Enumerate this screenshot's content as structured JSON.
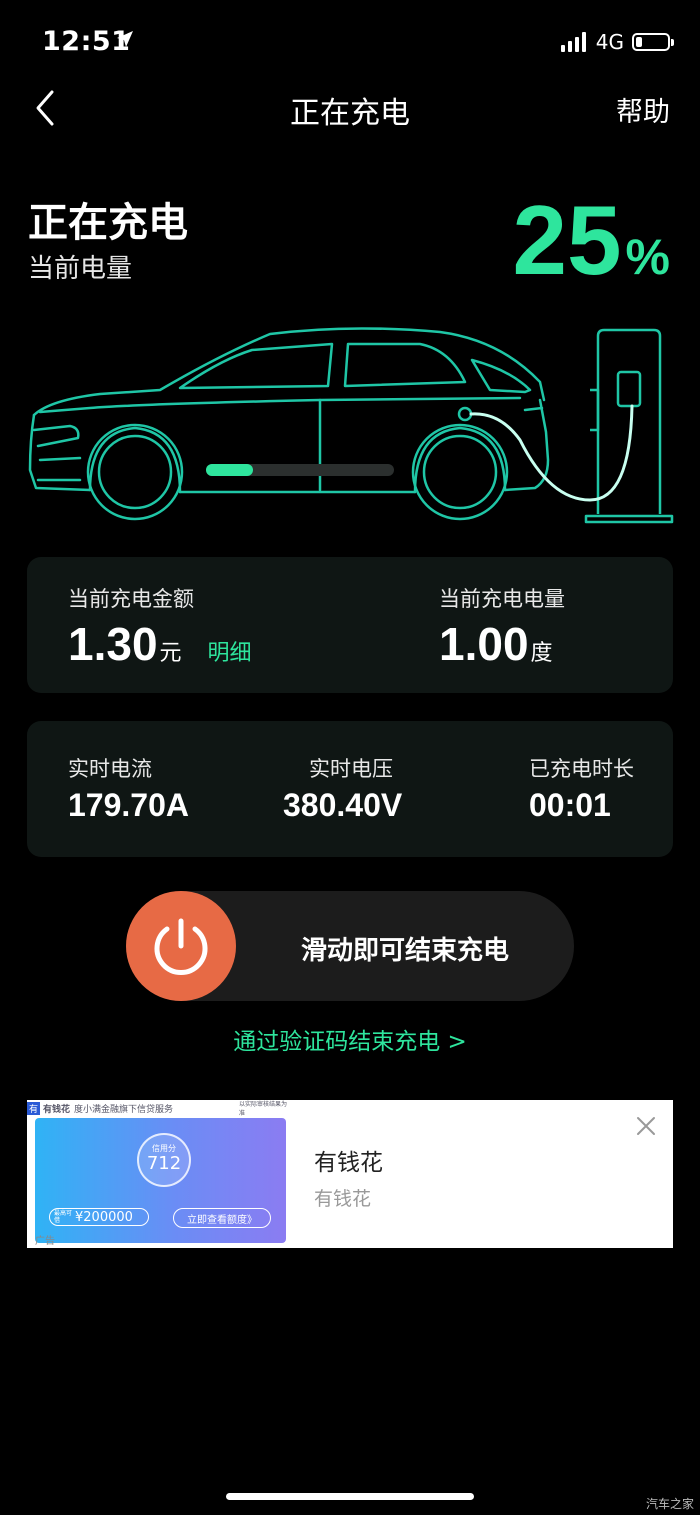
{
  "status_bar": {
    "time": "12:51",
    "network": "4G",
    "battery_level": 0.2
  },
  "nav": {
    "title": "正在充电",
    "help": "帮助"
  },
  "header": {
    "status": "正在充电",
    "label": "当前电量",
    "percent": "25",
    "percent_unit": "%"
  },
  "charge_progress": 0.25,
  "summary": {
    "amount_label": "当前充电金额",
    "amount_value": "1.30",
    "amount_unit": "元",
    "detail_link": "明细",
    "energy_label": "当前充电电量",
    "energy_value": "1.00",
    "energy_unit": "度"
  },
  "metrics": [
    {
      "label": "实时电流",
      "value": "179.70A"
    },
    {
      "label": "实时电压",
      "value": "380.40V"
    },
    {
      "label": "已充电时长",
      "value": "00:01"
    }
  ],
  "slider": {
    "text": "滑动即可结束充电"
  },
  "verify_link": "通过验证码结束充电 >",
  "ad": {
    "brand": "有钱花",
    "brand_desc": "度小满金融旗下信贷服务",
    "disclaimer": "以实际审核结果为准",
    "score_label": "信用分",
    "score": "712",
    "limit_label": "最高可借",
    "limit": "¥200000",
    "cta": "立即查看额度》",
    "tag": "广告",
    "title": "有钱花",
    "subtitle": "有钱花"
  },
  "watermark": "汽车之家",
  "colors": {
    "accent": "#2ee59d",
    "knob": "#e76a45",
    "car_outline": "#1fc6a6"
  }
}
